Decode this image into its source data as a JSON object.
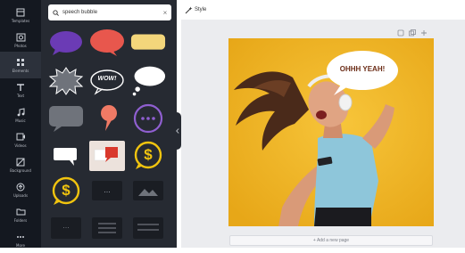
{
  "rail": {
    "items": [
      {
        "label": "Templates",
        "icon": "template-icon"
      },
      {
        "label": "Photos",
        "icon": "photo-icon"
      },
      {
        "label": "Elements",
        "icon": "elements-icon",
        "active": true
      },
      {
        "label": "Text",
        "icon": "text-icon"
      },
      {
        "label": "Music",
        "icon": "music-icon"
      },
      {
        "label": "Videos",
        "icon": "video-icon"
      },
      {
        "label": "Background",
        "icon": "background-icon"
      },
      {
        "label": "Uploads",
        "icon": "upload-icon"
      },
      {
        "label": "Folders",
        "icon": "folder-icon"
      },
      {
        "label": "More",
        "icon": "more-icon"
      }
    ]
  },
  "search": {
    "query": "speech bubble",
    "icon": "search-icon",
    "clear_icon": "close-icon"
  },
  "elements": {
    "bubble_text_wow": "WOW!",
    "dots": "...",
    "dollar": "$"
  },
  "toolbar": {
    "style_label": "Style",
    "style_icon": "magic-wand-icon",
    "page_tools": [
      "note-icon",
      "copy-icon",
      "add-icon"
    ]
  },
  "design": {
    "bubble_text": "OHHH YEAH!"
  },
  "add_page_label": "+ Add a new page",
  "colors": {
    "rail_bg": "#141820",
    "panel_bg": "#262a32",
    "purple_bubble": "#6b3bb5",
    "red_bubble": "#e8574d",
    "yellow_bubble": "#f3d67b",
    "gold": "#f1c40f",
    "design_bg": "#f0b72b",
    "shirt": "#8ec6da"
  }
}
